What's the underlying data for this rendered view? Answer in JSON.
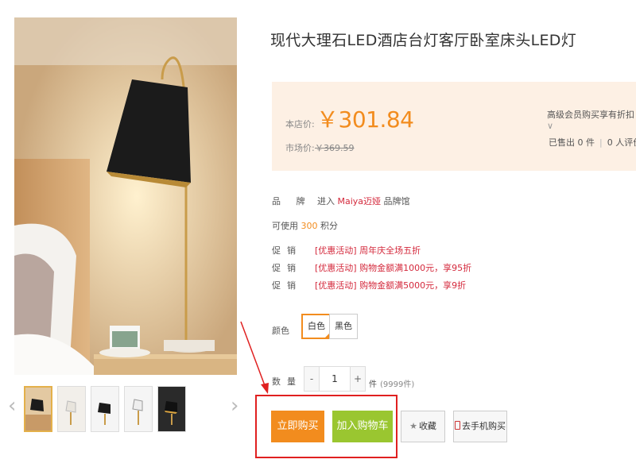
{
  "product": {
    "title": "现代大理石LED酒店台灯客厅卧室床头LED灯"
  },
  "price": {
    "store_label": "本店价:",
    "store_price": "￥301.84",
    "market_label": "市场价:",
    "market_price": "￥369.59",
    "member_note": "高级会员购买享有折扣",
    "sold": "已售出 0 件",
    "reviews": "0 人评价"
  },
  "brand": {
    "label": "品 牌",
    "prefix": "进入",
    "name": "Maiya迈娅",
    "suffix": "品牌馆"
  },
  "points": {
    "prefix": "可使用",
    "value": "300",
    "suffix": "积分"
  },
  "promotions": [
    {
      "label": "促销",
      "text": "[优惠活动] 周年庆全场五折"
    },
    {
      "label": "促销",
      "text": "[优惠活动] 购物金额满1000元，享95折"
    },
    {
      "label": "促销",
      "text": "[优惠活动] 购物金额满5000元，享9折"
    }
  ],
  "color": {
    "label": "颜色",
    "options": [
      "白色",
      "黑色"
    ],
    "selected": "白色"
  },
  "quantity": {
    "label": "数量",
    "minus": "-",
    "value": "1",
    "plus": "+",
    "unit": "件",
    "stock": "(9999件)"
  },
  "actions": {
    "buy_now": "立即购买",
    "add_to_cart": "加入购物车",
    "favorite": "收藏",
    "mobile_buy": "去手机购买"
  },
  "gallery": {
    "prev": "‹",
    "next": "›",
    "thumb_count": 5
  },
  "colors": {
    "price_orange": "#f28c1e",
    "promo_red": "#d4293c",
    "cart_green": "#9ac630",
    "price_box_bg": "#fdf0e4",
    "annotation_red": "#e02020"
  }
}
